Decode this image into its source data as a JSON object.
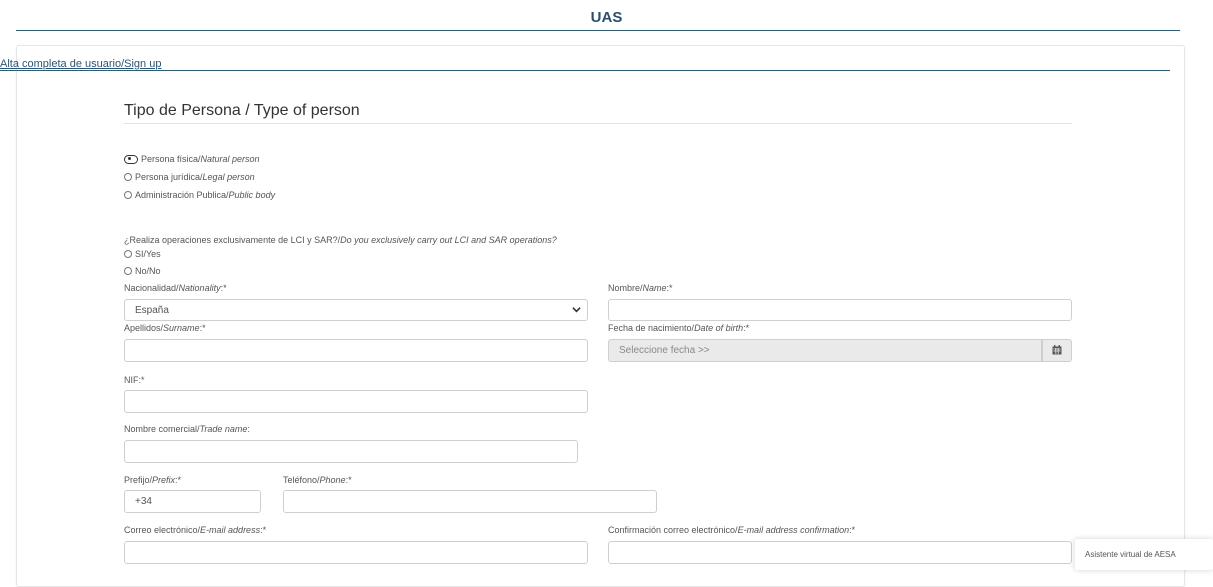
{
  "app": {
    "title": "UAS"
  },
  "breadcrumb": "Alta completa de usuario/Sign up",
  "section": {
    "title": "Tipo de Persona / Type of person"
  },
  "person_type": {
    "options": [
      {
        "es": "Persona física/",
        "en": "Natural person",
        "selected": true
      },
      {
        "es": "Persona jurídica/",
        "en": "Legal person",
        "selected": false
      },
      {
        "es": "Administración Publica/",
        "en": "Public body",
        "selected": false
      }
    ]
  },
  "lci_sar": {
    "question_es": "¿Realiza operaciones exclusivamente de LCI y SAR?/",
    "question_en": "Do you exclusively carry out LCI and SAR operations?",
    "options": [
      {
        "label": "SI/Yes",
        "selected": false
      },
      {
        "label": "No/No",
        "selected": false
      }
    ]
  },
  "fields": {
    "nationality": {
      "label_es": "Nacionalidad/",
      "label_en": "Nationality",
      "suffix": ":*",
      "value": "España"
    },
    "name": {
      "label_es": "Nombre/",
      "label_en": "Name",
      "suffix": ":*",
      "value": ""
    },
    "surname": {
      "label_es": "Apellidos/",
      "label_en": "Surname",
      "suffix": ":*",
      "value": ""
    },
    "birth_date": {
      "label_es": "Fecha de nacimiento/",
      "label_en": "Date of birth",
      "suffix": ":*",
      "placeholder": "Seleccione fecha >>"
    },
    "nif": {
      "label": "NIF:*",
      "value": ""
    },
    "trade_name": {
      "label_es": "Nombre comercial/",
      "label_en": "Trade name",
      "suffix": ":",
      "value": ""
    },
    "prefix": {
      "label_es": "Prefijo/",
      "label_en": "Prefix",
      "suffix": ":*",
      "value": "+34"
    },
    "phone": {
      "label_es": "Teléfono/",
      "label_en": "Phone",
      "suffix": ":*",
      "value": ""
    },
    "email": {
      "label_es": "Correo electrónico/",
      "label_en": "E-mail address",
      "suffix": ":*",
      "value": ""
    },
    "email_confirm": {
      "label_es": "Confirmación correo electrónico/",
      "label_en": "E-mail address confirmation",
      "suffix": ":*",
      "value": ""
    }
  },
  "chat": {
    "label": "Asistente virtual de AESA"
  },
  "icons": {
    "select_chevron": "chevron-down-icon",
    "calendar": "calendar-icon"
  }
}
